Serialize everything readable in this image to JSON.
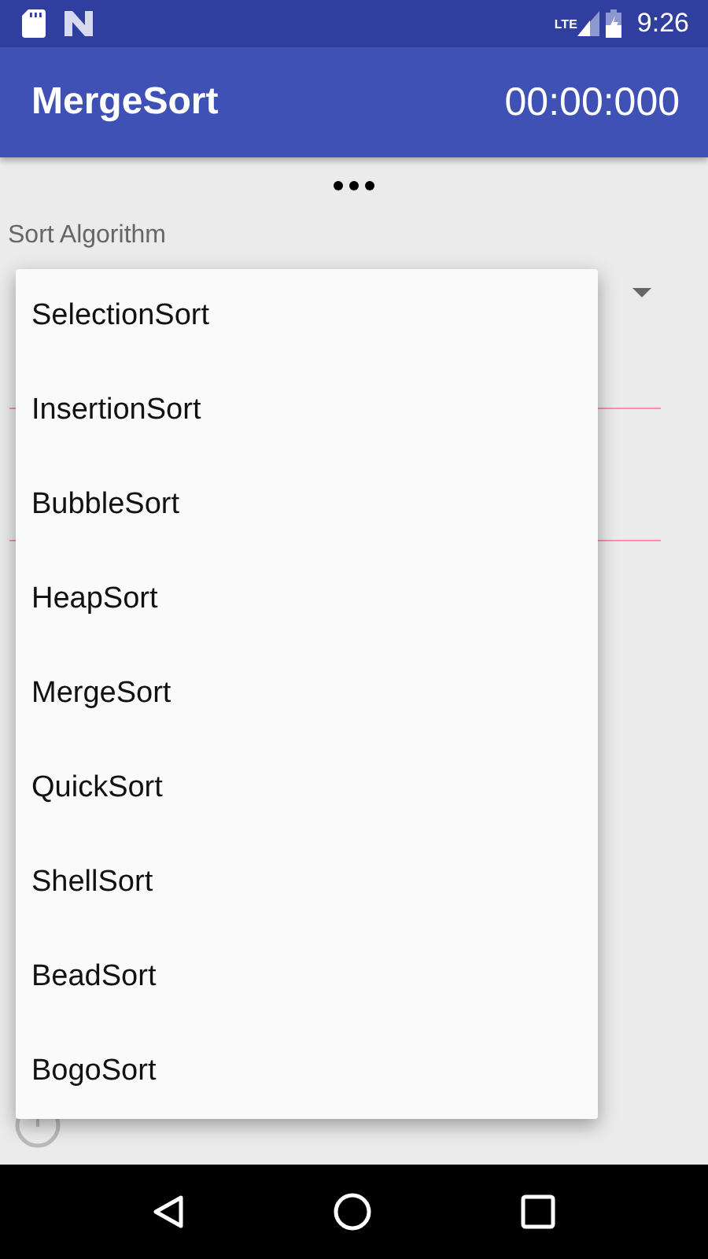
{
  "status_bar": {
    "time": "9:26",
    "network_label": "LTE"
  },
  "app_bar": {
    "title": "MergeSort",
    "timer": "00:00:000"
  },
  "form": {
    "label": "Sort Algorithm"
  },
  "dropdown": {
    "options": [
      "SelectionSort",
      "InsertionSort",
      "BubbleSort",
      "HeapSort",
      "MergeSort",
      "QuickSort",
      "ShellSort",
      "BeadSort",
      "BogoSort"
    ]
  }
}
